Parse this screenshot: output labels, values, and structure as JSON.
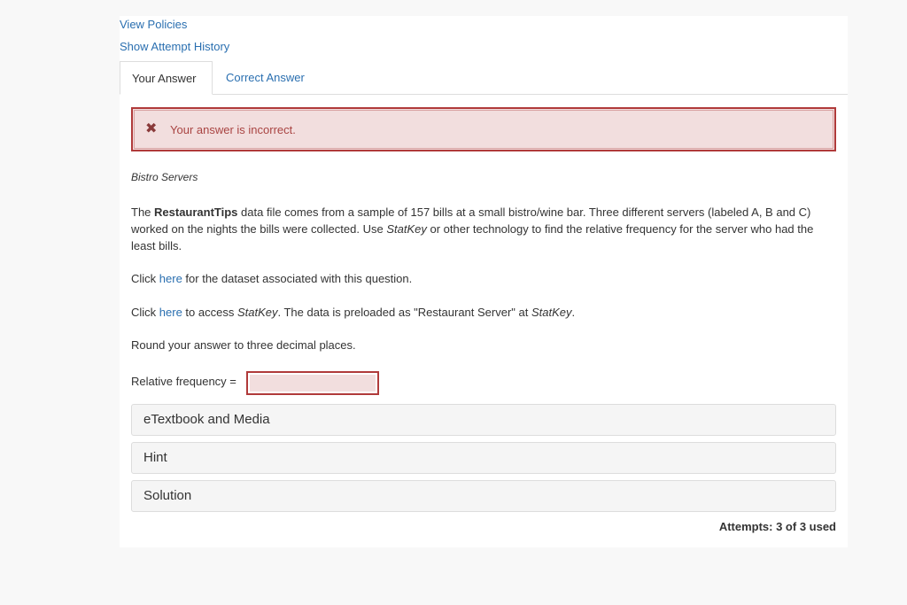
{
  "links": {
    "view_policies": "View Policies",
    "show_attempt_history": "Show Attempt History"
  },
  "tabs": {
    "your_answer": "Your Answer",
    "correct_answer": "Correct Answer"
  },
  "alert": {
    "icon": "x-icon",
    "text": "Your answer is incorrect."
  },
  "question": {
    "title": "Bistro Servers",
    "p1": {
      "pre": "The ",
      "bold": "RestaurantTips",
      "mid": " data file comes from a sample of 157 bills at a small bistro/wine bar. Three different servers (labeled A, B and C) worked on the nights the bills were collected. Use ",
      "italic": "StatKey",
      "post": " or other technology to find the relative frequency for the server who had the least bills."
    },
    "p2": {
      "pre": "Click ",
      "link": "here",
      "post": " for the dataset associated with this question."
    },
    "p3": {
      "pre": "Click ",
      "link": "here",
      "mid": " to access ",
      "italic1": "StatKey",
      "mid2": ". The data is preloaded as \"Restaurant Server\" at ",
      "italic2": "StatKey",
      "post": "."
    },
    "p4": "Round your answer to three decimal places.",
    "rf_label": "Relative frequency =",
    "rf_value": ""
  },
  "accordions": [
    "eTextbook and Media",
    "Hint",
    "Solution"
  ],
  "attempts": "Attempts: 3 of 3 used",
  "colors": {
    "link": "#2a6fb0",
    "error_border": "#b03a3a",
    "error_bg": "#f2dede"
  }
}
